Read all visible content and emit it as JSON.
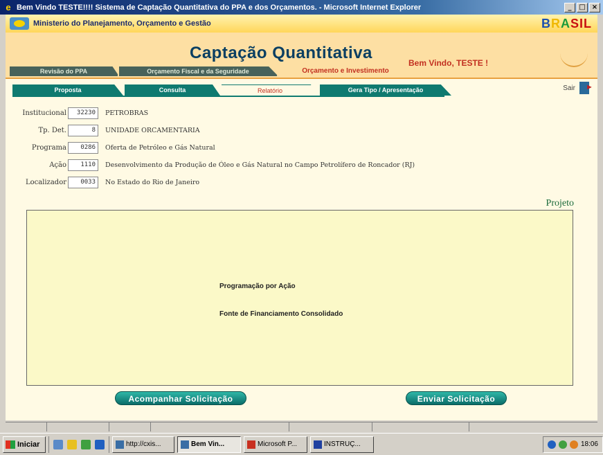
{
  "window": {
    "title": "Bem Vindo TESTE!!!! Sistema de Captação Quantitativa do PPA e dos Orçamentos. - Microsoft Internet Explorer",
    "controls": [
      "_",
      "□",
      "×"
    ]
  },
  "header": {
    "ministry": "Ministerio do Planejamento, Orçamento e Gestão",
    "brand": [
      "B",
      "R",
      "A",
      "SIL"
    ]
  },
  "banner": {
    "app_title": "Captação Quantitativa",
    "welcome": "Bem Vindo, TESTE  !",
    "tabs": [
      "Revisão do PPA",
      "Orçamento Fiscal e da Seguridade",
      "Orçamento e Investimento"
    ]
  },
  "subnav": {
    "tabs": [
      "Proposta",
      "Consulta",
      "Relatório",
      "Gera Tipo / Apresentação"
    ],
    "exit_label": "Sair"
  },
  "fields": [
    {
      "label": "Institucional",
      "value": "32230",
      "desc": "PETROBRAS"
    },
    {
      "label": "Tp. Det.",
      "value": "8",
      "desc": "UNIDADE ORCAMENTARIA"
    },
    {
      "label": "Programa",
      "value": "0286",
      "desc": "Oferta de Petróleo e Gás Natural"
    },
    {
      "label": "Ação",
      "value": "1110",
      "desc": "Desenvolvimento da Produção de Óleo e Gás Natural no Campo Petrolífero de Roncador (RJ)"
    },
    {
      "label": "Localizador",
      "value": "0033",
      "desc": "No Estado do Rio de Janeiro"
    }
  ],
  "section": {
    "heading": "Projeto",
    "links": [
      "Programação por Ação",
      "Fonte de Financiamento Consolidado"
    ]
  },
  "actions": {
    "track": "Acompanhar Solicitação",
    "send": "Enviar Solicitação"
  },
  "taskbar": {
    "start": "Iniciar",
    "tasks": [
      "http://cxis...",
      "Bem Vin...",
      "Microsoft P...",
      "INSTRUÇ..."
    ],
    "clock": "18:06"
  }
}
